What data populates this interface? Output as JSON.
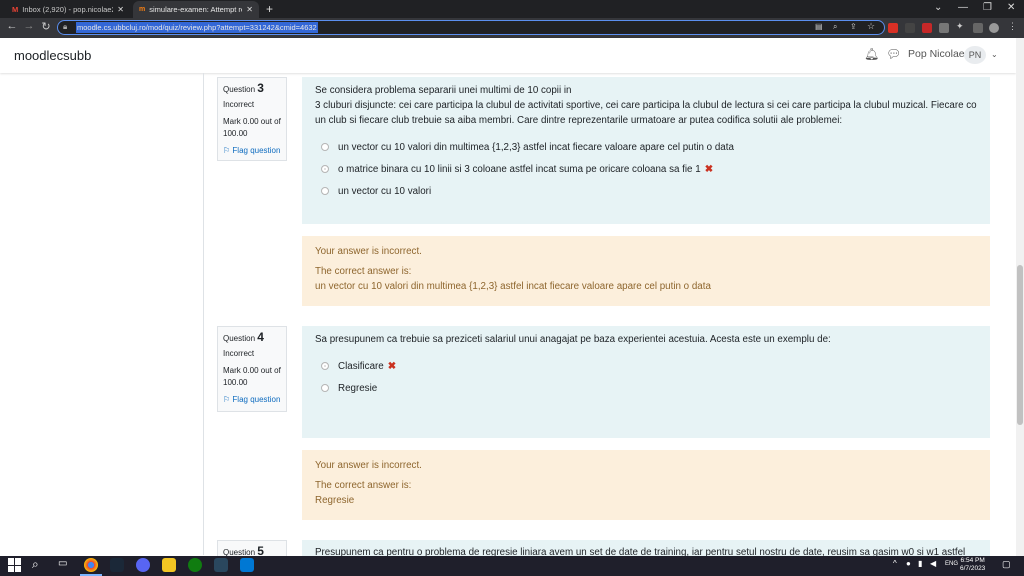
{
  "browser": {
    "tabs": [
      {
        "title": "Inbox (2,920) - pop.nicolae2001@",
        "favicon": "gmail-icon"
      },
      {
        "title": "simulare-examen: Attempt revie",
        "favicon": "moodle-icon"
      }
    ],
    "new_tab": "+",
    "url": "moodle.cs.ubbcluj.ro/mod/quiz/review.php?attempt=331242&cmid=4632"
  },
  "moodle": {
    "brand": "moodlecsubb",
    "user_name": "Pop Nicolae",
    "user_initials": "PN"
  },
  "questions": [
    {
      "label": "Question",
      "number": "3",
      "status": "Incorrect",
      "mark": "Mark 0.00 out of 100.00",
      "flag": "Flag question",
      "text_line1": "Se considera problema separarii unei multimi de 10 copii in",
      "text_line2": "3 cluburi disjuncte: cei care participa la clubul de activitati sportive, cei care participa la clubul de lectura si cei care participa la clubul muzical. Fiecare copil trebuie sa fie",
      "text_line3": "un club si fiecare club trebuie sa aiba membri. Care dintre reprezentarile urmatoare ar putea codifica solutii ale problemei:",
      "answers": [
        "un vector cu 10 valori din multimea {1,2,3} astfel incat fiecare valoare apare cel putin o data",
        "o matrice binara cu 10 linii si 3 coloane astfel incat suma pe oricare coloana sa fie 1",
        "un vector cu 10 valori"
      ],
      "feedback_incorrect": "Your answer is incorrect.",
      "feedback_correct_label": "The correct answer is:",
      "feedback_correct_answer": "un vector cu 10 valori din multimea {1,2,3} astfel incat fiecare valoare apare cel putin o data"
    },
    {
      "label": "Question",
      "number": "4",
      "status": "Incorrect",
      "mark": "Mark 0.00 out of 100.00",
      "flag": "Flag question",
      "text_line1": "Sa presupunem ca trebuie sa preziceti salariul unui anagajat pe baza experientei acestuia. Acesta este un exemplu de:",
      "answers": [
        "Clasificare",
        "Regresie"
      ],
      "feedback_incorrect": "Your answer is incorrect.",
      "feedback_correct_label": "The correct answer is:",
      "feedback_correct_answer": "Regresie"
    },
    {
      "label": "Question",
      "number": "5",
      "text_line1": "Presupunem ca pentru o problema de regresie liniara avem un set de date de training, iar pentru setul nostru de date, reusim sa gasim w0 si w1 astfel"
    }
  ],
  "taskbar": {
    "lang": "ENG",
    "time": "6:54 PM",
    "date": "6/7/2023"
  },
  "colors": {
    "question_bg": "#e7f3f5",
    "feedback_bg": "#fcefdc",
    "feedback_text": "#8e662e",
    "incorrect_mark": "#ca3120",
    "link": "#0f6cbf"
  }
}
